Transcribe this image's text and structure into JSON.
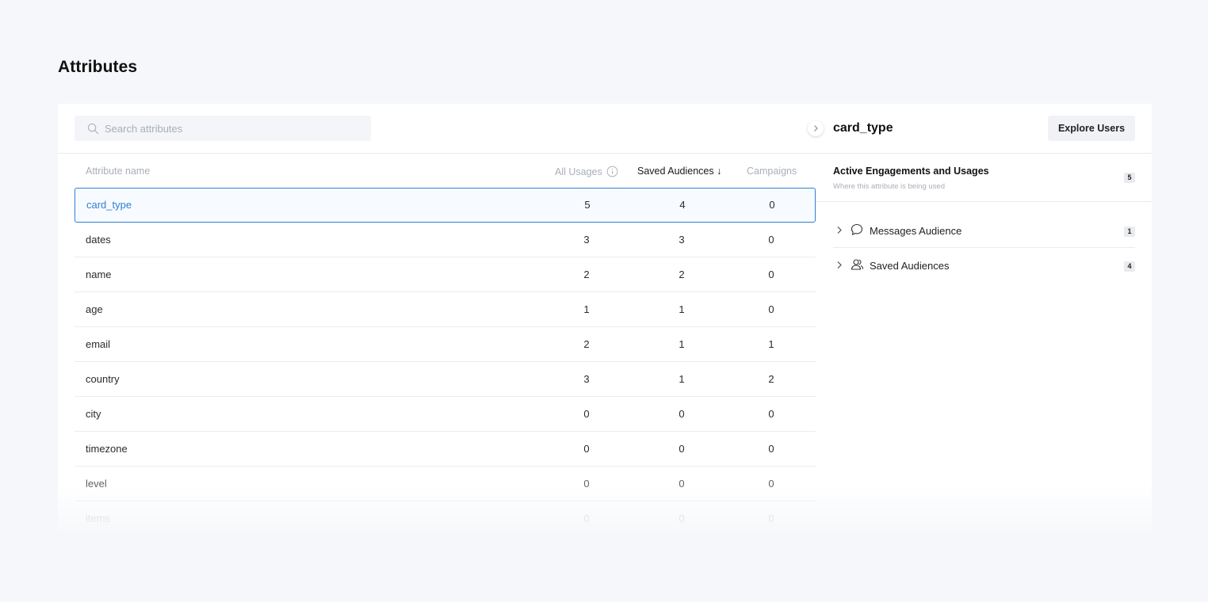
{
  "page": {
    "title": "Attributes"
  },
  "search": {
    "placeholder": "Search attributes",
    "value": ""
  },
  "table": {
    "columns": {
      "name": "Attribute name",
      "usages": "All Usages",
      "saved": "Saved Audiences ↓",
      "campaigns": "Campaigns"
    },
    "rows": [
      {
        "name": "card_type",
        "usages": "5",
        "saved": "4",
        "campaigns": "0"
      },
      {
        "name": "dates",
        "usages": "3",
        "saved": "3",
        "campaigns": "0"
      },
      {
        "name": "name",
        "usages": "2",
        "saved": "2",
        "campaigns": "0"
      },
      {
        "name": "age",
        "usages": "1",
        "saved": "1",
        "campaigns": "0"
      },
      {
        "name": "email",
        "usages": "2",
        "saved": "1",
        "campaigns": "1"
      },
      {
        "name": "country",
        "usages": "3",
        "saved": "1",
        "campaigns": "2"
      },
      {
        "name": "city",
        "usages": "0",
        "saved": "0",
        "campaigns": "0"
      },
      {
        "name": "timezone",
        "usages": "0",
        "saved": "0",
        "campaigns": "0"
      },
      {
        "name": "level",
        "usages": "0",
        "saved": "0",
        "campaigns": "0"
      },
      {
        "name": "items",
        "usages": "0",
        "saved": "0",
        "campaigns": "0"
      }
    ],
    "selected_index": 0
  },
  "detail": {
    "title": "card_type",
    "explore_label": "Explore Users",
    "section_title": "Active Engagements and Usages",
    "section_subtitle": "Where this attribute is being used",
    "section_count": "5",
    "items": [
      {
        "label": "Messages Audience",
        "count": "1",
        "icon": "chat-bubble-icon"
      },
      {
        "label": "Saved Audiences",
        "count": "4",
        "icon": "users-icon"
      }
    ]
  },
  "colors": {
    "accent": "#2f7fd6",
    "background": "#f5f7fa",
    "muted_text": "#a9afb8"
  }
}
